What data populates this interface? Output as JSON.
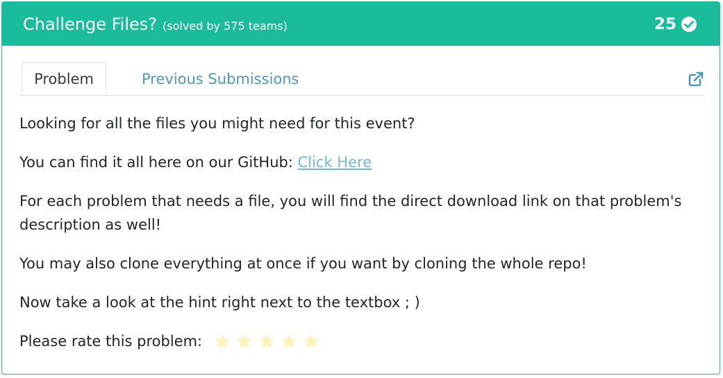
{
  "header": {
    "title": "Challenge Files?",
    "solved": "(solved by 575 teams)",
    "points": "25"
  },
  "tabs": {
    "problem": "Problem",
    "submissions": "Previous Submissions"
  },
  "body": {
    "p1": "Looking for all the files you might need for this event?",
    "p2_prefix": "You can find it all here on our GitHub: ",
    "p2_link": "Click Here",
    "p3": "For each problem that needs a file, you will find the direct download link on that problem's description as well!",
    "p4": "You may also clone everything at once if you want by cloning the whole repo!",
    "p5": "Now take a look at the hint right next to the textbox ; )",
    "rate_label": "Please rate this problem:"
  },
  "rating": {
    "max": 5,
    "value": 0
  },
  "colors": {
    "header_bg": "#1abc9c",
    "tab_link": "#4a9ab8",
    "link": "#6fb6d3",
    "star": "#fff3b8"
  },
  "icons": {
    "solved": "check-circle-icon",
    "open": "external-link-icon",
    "rating": "star-icon"
  }
}
